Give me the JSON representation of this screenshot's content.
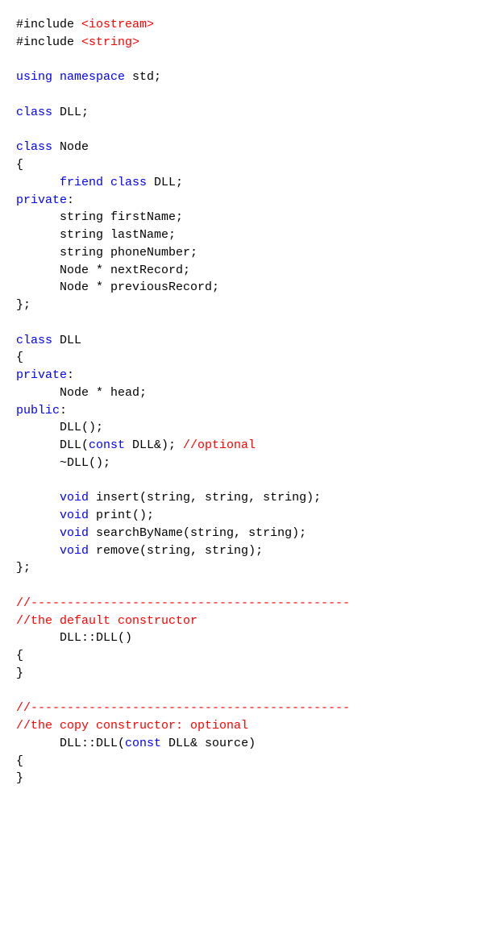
{
  "lines": [
    {
      "text": "#include <iostream>",
      "segments": [
        [
          "#include ",
          "b"
        ],
        [
          "<iostream>",
          "r"
        ]
      ]
    },
    {
      "text": "#include <string>",
      "segments": [
        [
          "#include ",
          "b"
        ],
        [
          "<string>",
          "r"
        ]
      ]
    },
    {
      "text": "",
      "segments": [
        [
          "",
          "b"
        ]
      ]
    },
    {
      "text": "using namespace std;",
      "segments": [
        [
          "using namespace",
          "k"
        ],
        [
          " std;",
          "b"
        ]
      ]
    },
    {
      "text": "",
      "segments": [
        [
          "",
          "b"
        ]
      ]
    },
    {
      "text": "class DLL;",
      "segments": [
        [
          "class",
          "k"
        ],
        [
          " DLL;",
          "b"
        ]
      ]
    },
    {
      "text": "",
      "segments": [
        [
          "",
          "b"
        ]
      ]
    },
    {
      "text": "class Node",
      "segments": [
        [
          "class",
          "k"
        ],
        [
          " Node",
          "b"
        ]
      ]
    },
    {
      "text": "{",
      "segments": [
        [
          "{",
          "b"
        ]
      ]
    },
    {
      "text": "      friend class DLL;",
      "segments": [
        [
          "      ",
          "b"
        ],
        [
          "friend class",
          "k"
        ],
        [
          " DLL;",
          "b"
        ]
      ]
    },
    {
      "text": "private:",
      "segments": [
        [
          "private",
          "k"
        ],
        [
          ":",
          "b"
        ]
      ]
    },
    {
      "text": "      string firstName;",
      "segments": [
        [
          "      string firstName;",
          "b"
        ]
      ]
    },
    {
      "text": "      string lastName;",
      "segments": [
        [
          "      string lastName;",
          "b"
        ]
      ]
    },
    {
      "text": "      string phoneNumber;",
      "segments": [
        [
          "      string phoneNumber;",
          "b"
        ]
      ]
    },
    {
      "text": "      Node * nextRecord;",
      "segments": [
        [
          "      Node * nextRecord;",
          "b"
        ]
      ]
    },
    {
      "text": "      Node * previousRecord;",
      "segments": [
        [
          "      Node * previousRecord;",
          "b"
        ]
      ]
    },
    {
      "text": "};",
      "segments": [
        [
          "};",
          "b"
        ]
      ]
    },
    {
      "text": "",
      "segments": [
        [
          "",
          "b"
        ]
      ]
    },
    {
      "text": "class DLL",
      "segments": [
        [
          "class",
          "k"
        ],
        [
          " DLL",
          "b"
        ]
      ]
    },
    {
      "text": "{",
      "segments": [
        [
          "{",
          "b"
        ]
      ]
    },
    {
      "text": "private:",
      "segments": [
        [
          "private",
          "k"
        ],
        [
          ":",
          "b"
        ]
      ]
    },
    {
      "text": "      Node * head;",
      "segments": [
        [
          "      Node * head;",
          "b"
        ]
      ]
    },
    {
      "text": "public:",
      "segments": [
        [
          "public",
          "k"
        ],
        [
          ":",
          "b"
        ]
      ]
    },
    {
      "text": "      DLL();",
      "segments": [
        [
          "      DLL();",
          "b"
        ]
      ]
    },
    {
      "text": "      DLL(const DLL&); //optional",
      "segments": [
        [
          "      DLL(",
          "b"
        ],
        [
          "const",
          "k"
        ],
        [
          " DLL&); ",
          "b"
        ],
        [
          "//optional",
          "r"
        ]
      ]
    },
    {
      "text": "      ~DLL();",
      "segments": [
        [
          "      ~DLL();",
          "b"
        ]
      ]
    },
    {
      "text": "",
      "segments": [
        [
          "",
          "b"
        ]
      ]
    },
    {
      "text": "      void insert(string, string, string);",
      "segments": [
        [
          "      ",
          "b"
        ],
        [
          "void",
          "k"
        ],
        [
          " insert(string, string, string);",
          "b"
        ]
      ]
    },
    {
      "text": "      void print();",
      "segments": [
        [
          "      ",
          "b"
        ],
        [
          "void",
          "k"
        ],
        [
          " print();",
          "b"
        ]
      ]
    },
    {
      "text": "      void searchByName(string, string);",
      "segments": [
        [
          "      ",
          "b"
        ],
        [
          "void",
          "k"
        ],
        [
          " searchByName(string, string);",
          "b"
        ]
      ]
    },
    {
      "text": "      void remove(string, string);",
      "segments": [
        [
          "      ",
          "b"
        ],
        [
          "void",
          "k"
        ],
        [
          " remove(string, string);",
          "b"
        ]
      ]
    },
    {
      "text": "};",
      "segments": [
        [
          "};",
          "b"
        ]
      ]
    },
    {
      "text": "",
      "segments": [
        [
          "",
          "b"
        ]
      ]
    },
    {
      "text": "//--------------------------------------------",
      "segments": [
        [
          "//--------------------------------------------",
          "r"
        ]
      ]
    },
    {
      "text": "//the default constructor",
      "segments": [
        [
          "//the default constructor",
          "r"
        ]
      ]
    },
    {
      "text": "      DLL::DLL()",
      "segments": [
        [
          "      DLL::DLL()",
          "b"
        ]
      ]
    },
    {
      "text": "{",
      "segments": [
        [
          "{",
          "b"
        ]
      ]
    },
    {
      "text": "}",
      "segments": [
        [
          "}",
          "b"
        ]
      ]
    },
    {
      "text": "",
      "segments": [
        [
          "",
          "b"
        ]
      ]
    },
    {
      "text": "//--------------------------------------------",
      "segments": [
        [
          "//--------------------------------------------",
          "r"
        ]
      ]
    },
    {
      "text": "//the copy constructor: optional",
      "segments": [
        [
          "//the copy constructor: optional",
          "r"
        ]
      ]
    },
    {
      "text": "      DLL::DLL(const DLL& source)",
      "segments": [
        [
          "      DLL::DLL(",
          "b"
        ],
        [
          "const",
          "k"
        ],
        [
          " DLL& source)",
          "b"
        ]
      ]
    },
    {
      "text": "{",
      "segments": [
        [
          "{",
          "b"
        ]
      ]
    },
    {
      "text": "}",
      "segments": [
        [
          "}",
          "b"
        ]
      ]
    }
  ]
}
